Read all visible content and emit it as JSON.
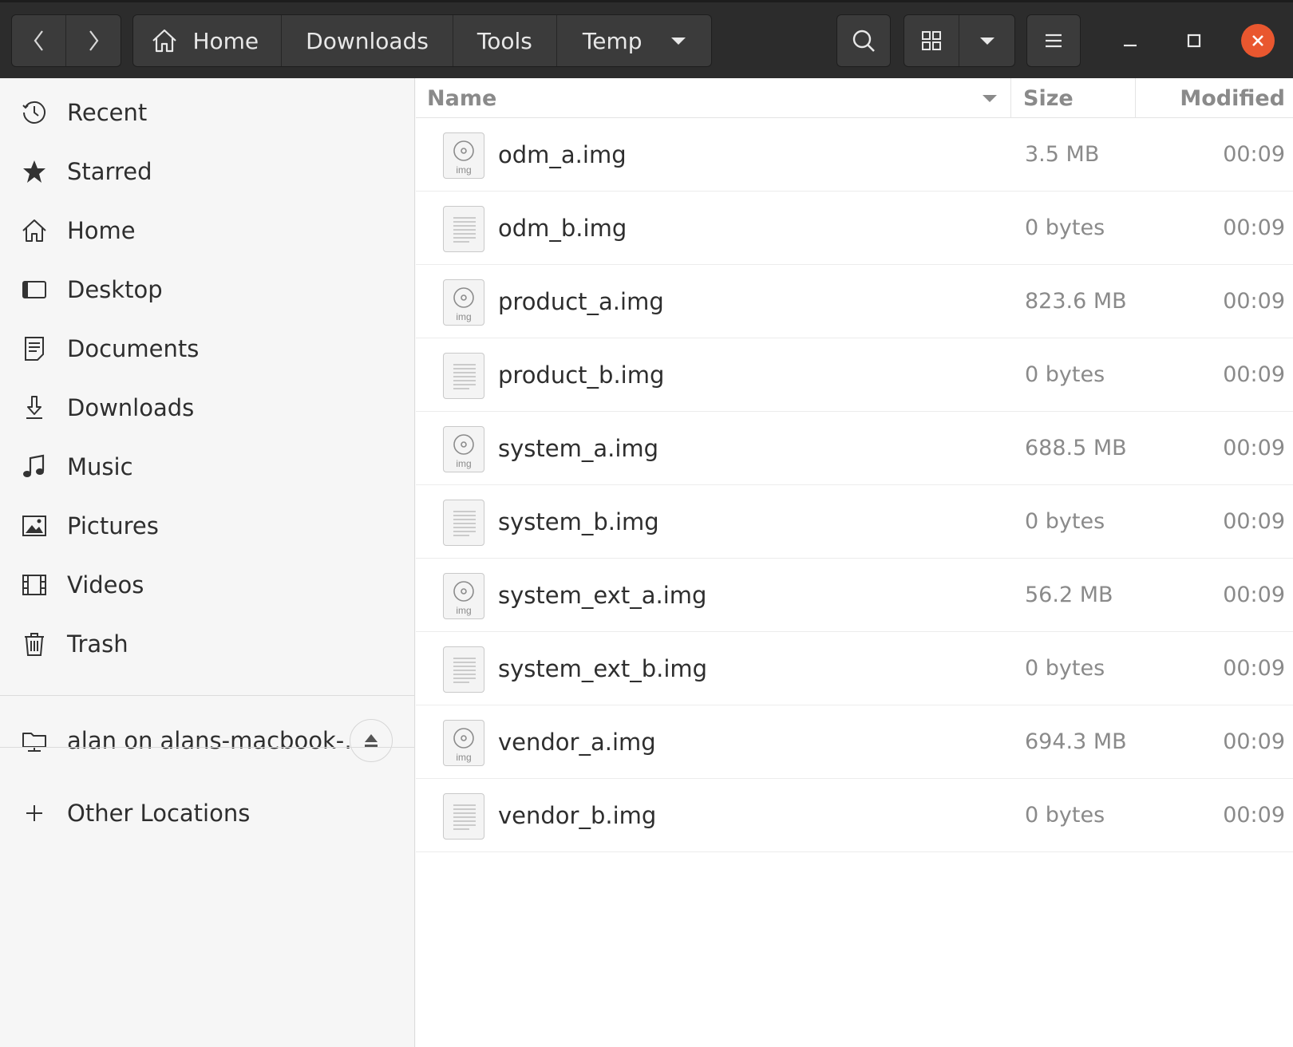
{
  "headerbar": {
    "nav": {
      "back_icon": "chevron-left-icon",
      "forward_icon": "chevron-right-icon"
    },
    "path": [
      {
        "label": "Home",
        "icon": "home-icon"
      },
      {
        "label": "Downloads"
      },
      {
        "label": "Tools"
      },
      {
        "label": "Temp",
        "current": true
      }
    ],
    "buttons": [
      "search-icon",
      "grid-view-icon",
      "view-options-dropdown-icon",
      "hamburger-menu-icon"
    ],
    "window_controls": [
      "minimize-icon",
      "maximize-icon",
      "close-icon"
    ],
    "close_color": "#e9572f"
  },
  "sidebar": {
    "items": [
      {
        "label": "Recent",
        "icon": "clock-icon"
      },
      {
        "label": "Starred",
        "icon": "star-icon"
      },
      {
        "label": "Home",
        "icon": "home-icon"
      },
      {
        "label": "Desktop",
        "icon": "desktop-icon"
      },
      {
        "label": "Documents",
        "icon": "document-icon"
      },
      {
        "label": "Downloads",
        "icon": "download-icon"
      },
      {
        "label": "Music",
        "icon": "music-icon"
      },
      {
        "label": "Pictures",
        "icon": "picture-icon"
      },
      {
        "label": "Videos",
        "icon": "video-icon"
      },
      {
        "label": "Trash",
        "icon": "trash-icon"
      }
    ],
    "network": {
      "label": "alan on alans-macbook-…",
      "icon": "network-folder-icon",
      "eject_icon": "eject-icon"
    },
    "other": {
      "label": "Other Locations",
      "icon": "plus-icon"
    }
  },
  "filelist": {
    "columns": {
      "name": "Name",
      "size": "Size",
      "modified": "Modified"
    },
    "files": [
      {
        "name": "odm_a.img",
        "size": "3.5 MB",
        "modified": "00:09",
        "icon": "disk-image-icon"
      },
      {
        "name": "odm_b.img",
        "size": "0 bytes",
        "modified": "00:09",
        "icon": "text-file-icon"
      },
      {
        "name": "product_a.img",
        "size": "823.6 MB",
        "modified": "00:09",
        "icon": "disk-image-icon"
      },
      {
        "name": "product_b.img",
        "size": "0 bytes",
        "modified": "00:09",
        "icon": "text-file-icon"
      },
      {
        "name": "system_a.img",
        "size": "688.5 MB",
        "modified": "00:09",
        "icon": "disk-image-icon"
      },
      {
        "name": "system_b.img",
        "size": "0 bytes",
        "modified": "00:09",
        "icon": "text-file-icon"
      },
      {
        "name": "system_ext_a.img",
        "size": "56.2 MB",
        "modified": "00:09",
        "icon": "disk-image-icon"
      },
      {
        "name": "system_ext_b.img",
        "size": "0 bytes",
        "modified": "00:09",
        "icon": "text-file-icon"
      },
      {
        "name": "vendor_a.img",
        "size": "694.3 MB",
        "modified": "00:09",
        "icon": "disk-image-icon"
      },
      {
        "name": "vendor_b.img",
        "size": "0 bytes",
        "modified": "00:09",
        "icon": "text-file-icon"
      }
    ],
    "img_label": "img"
  }
}
